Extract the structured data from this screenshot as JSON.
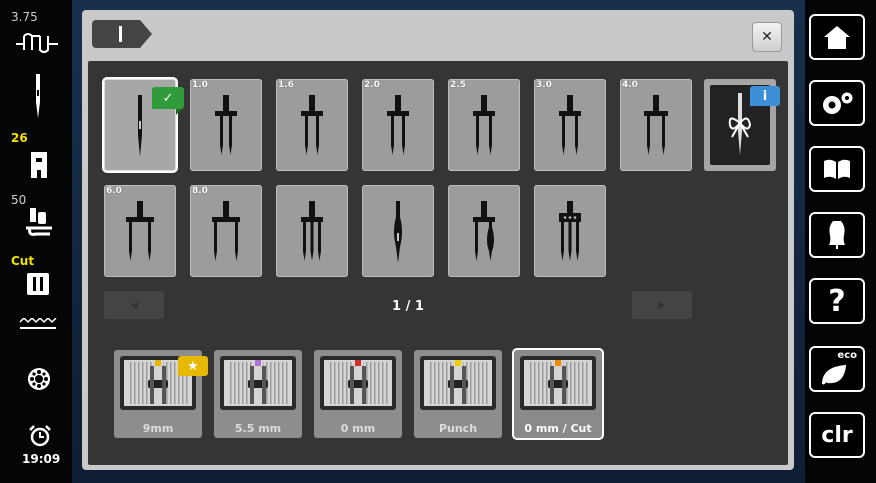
{
  "left_bar": {
    "stitch_width": "3.75",
    "presser_pressure": "26",
    "thread_tension": "50",
    "cutter_mode": "Cut",
    "clock_time": "19:09"
  },
  "needle_panel": {
    "needles": [
      {
        "label": "",
        "icon": "single-needle-icon",
        "selected": true,
        "badge": "checkmark"
      },
      {
        "label": "1.0",
        "icon": "twin-needle-icon"
      },
      {
        "label": "1.6",
        "icon": "twin-needle-icon"
      },
      {
        "label": "2.0",
        "icon": "twin-needle-icon"
      },
      {
        "label": "2.5",
        "icon": "twin-needle-icon"
      },
      {
        "label": "3.0",
        "icon": "twin-needle-icon"
      },
      {
        "label": "4.0",
        "icon": "twin-needle-icon"
      },
      {
        "label": "6.0",
        "icon": "twin-needle-icon"
      },
      {
        "label": "8.0",
        "icon": "twin-needle-icon"
      },
      {
        "label": "",
        "icon": "triple-needle-icon"
      },
      {
        "label": "",
        "icon": "wing-needle-icon"
      },
      {
        "label": "",
        "icon": "double-wing-needle-icon"
      },
      {
        "label": "",
        "icon": "quadruple-needle-icon"
      }
    ],
    "info_card": {
      "icon": "needle-info-icon",
      "badge": "i"
    },
    "page_indicator": "1 / 1"
  },
  "presser_feet": [
    {
      "label": "9mm",
      "color": "#e6b800",
      "badge": "star"
    },
    {
      "label": "5.5 mm",
      "color": "#b26fd6"
    },
    {
      "label": "0 mm",
      "color": "#d42a2a"
    },
    {
      "label": "Punch",
      "color": "#f0d000"
    },
    {
      "label": "0 mm / Cut",
      "color": "#f08a00",
      "selected": true
    }
  ],
  "right_bar": {
    "home": "home-icon",
    "settings": "gears-icon",
    "guide": "book-icon",
    "help_creative": "dress-form-icon",
    "help": "?",
    "eco": "eco",
    "clear": "clr"
  }
}
